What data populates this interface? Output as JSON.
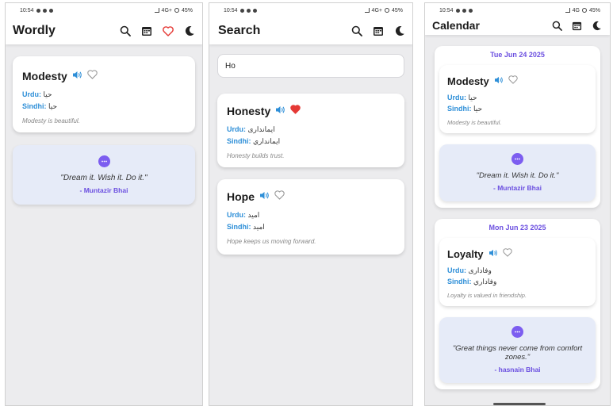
{
  "status": {
    "p1_time": "10:54",
    "p1_battery": "45%",
    "p1_net": "4G+",
    "p2_time": "10:54",
    "p2_battery": "45%",
    "p2_net": "4G+",
    "p3_time": "10:54",
    "p3_battery": "45%",
    "p3_net": "4G"
  },
  "home": {
    "title": "Wordly",
    "card": {
      "word": "Modesty",
      "urdu_label": "Urdu:",
      "urdu": "حیا",
      "sindhi_label": "Sindhi:",
      "sindhi": "حيا",
      "example": "Modesty is beautiful."
    },
    "quote": {
      "text": "\"Dream it. Wish it. Do it.\"",
      "author": "- Muntazir Bhai"
    }
  },
  "search": {
    "title": "Search",
    "query": "Ho",
    "results": [
      {
        "word": "Honesty",
        "favorite": true,
        "urdu_label": "Urdu:",
        "urdu": "ایمانداری",
        "sindhi_label": "Sindhi:",
        "sindhi": "ايمانداري",
        "example": "Honesty builds trust."
      },
      {
        "word": "Hope",
        "favorite": false,
        "urdu_label": "Urdu:",
        "urdu": "امید",
        "sindhi_label": "Sindhi:",
        "sindhi": "اميد",
        "example": "Hope keeps us moving forward."
      }
    ]
  },
  "calendar": {
    "title": "Calendar",
    "days": [
      {
        "date": "Tue Jun 24 2025",
        "word": "Modesty",
        "urdu_label": "Urdu:",
        "urdu": "حیا",
        "sindhi_label": "Sindhi:",
        "sindhi": "حيا",
        "example": "Modesty is beautiful.",
        "quote_text": "\"Dream it. Wish it. Do it.\"",
        "quote_author": "- Muntazir Bhai"
      },
      {
        "date": "Mon Jun 23 2025",
        "word": "Loyalty",
        "urdu_label": "Urdu:",
        "urdu": "وفاداری",
        "sindhi_label": "Sindhi:",
        "sindhi": "وفاداري",
        "example": "Loyalty is valued in friendship.",
        "quote_text": "\"Great things never come from comfort zones.\"",
        "quote_author": "- hasnain Bhai"
      }
    ]
  },
  "icons": {
    "search": "search-icon",
    "calendar": "calendar-icon",
    "heart": "heart-icon",
    "moon": "moon-icon",
    "speaker": "speaker-icon",
    "quote": "chat-bubble-icon"
  },
  "colors": {
    "accent": "#6b4fe0",
    "lang_label": "#2e8fd8",
    "favorite": "#e53935",
    "heart_outline": "#999999",
    "speaker": "#2e8fd8",
    "quote_bg": "#e6ebf8",
    "panel_bg": "#ececee"
  }
}
